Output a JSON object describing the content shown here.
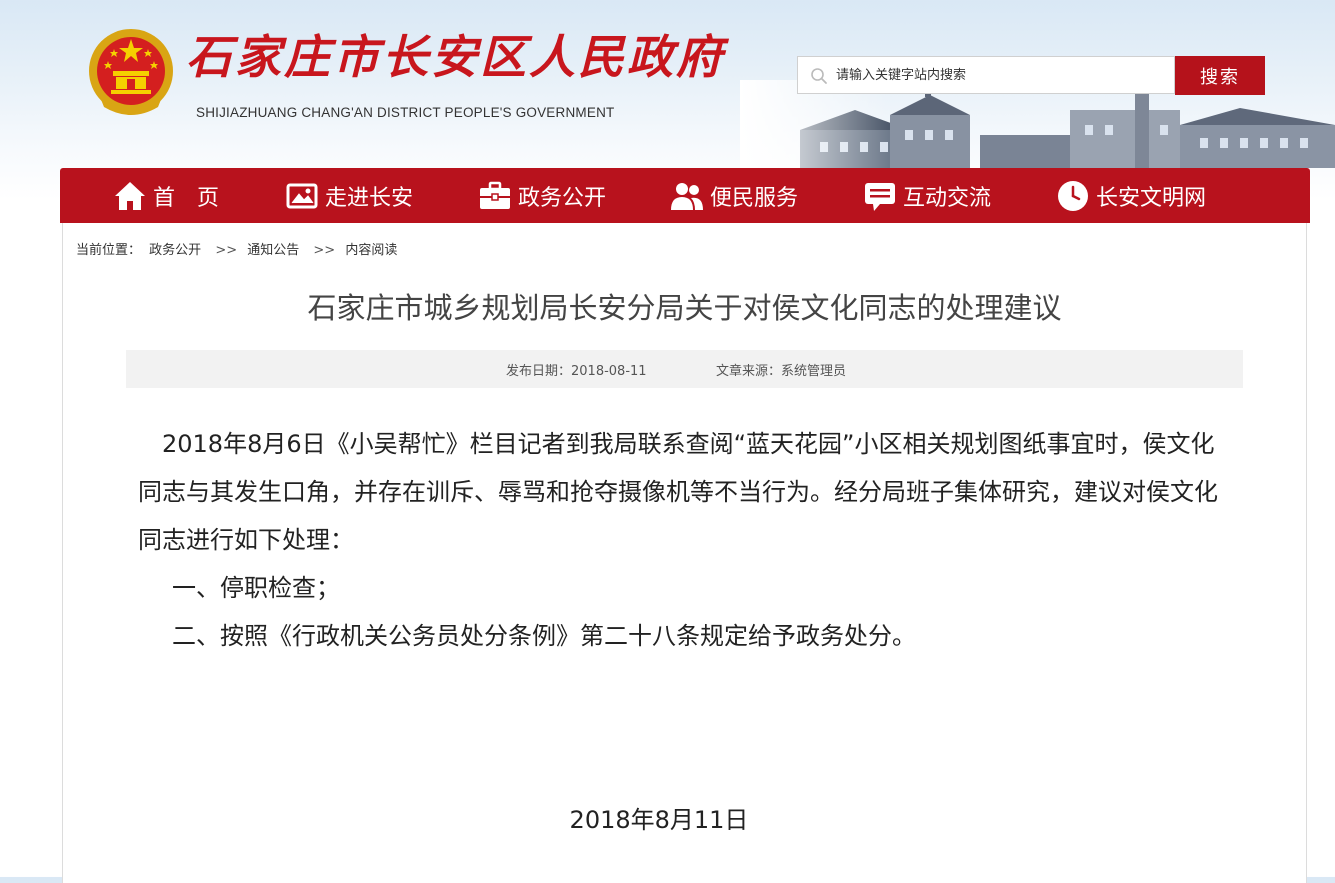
{
  "header": {
    "title": "石家庄市长安区人民政府",
    "subtitle": "SHIJIAZHUANG CHANG'AN DISTRICT PEOPLE'S GOVERNMENT",
    "search_placeholder": "请输入关键字站内搜索",
    "search_button": "搜索"
  },
  "colors": {
    "brand_red": "#b8121d",
    "button_red": "#b5121b",
    "meta_bg": "#f2f2f2"
  },
  "nav": {
    "items": [
      {
        "label": "首页",
        "icon": "home-icon"
      },
      {
        "label": "走进长安",
        "icon": "picture-icon"
      },
      {
        "label": "政务公开",
        "icon": "briefcase-icon"
      },
      {
        "label": "便民服务",
        "icon": "people-icon"
      },
      {
        "label": "互动交流",
        "icon": "chat-icon"
      },
      {
        "label": "长安文明网",
        "icon": "clock-icon"
      }
    ]
  },
  "breadcrumb": {
    "prefix": "当前位置：",
    "items": [
      "政务公开",
      "通知公告",
      "内容阅读"
    ],
    "separator": ">>"
  },
  "article": {
    "title": "石家庄市城乡规划局长安分局关于对侯文化同志的处理建议",
    "publish_date": "发布日期：2018-08-11",
    "source": "文章来源：系统管理员",
    "paragraphs": [
      "2018年8月6日《小吴帮忙》栏目记者到我局联系查阅“蓝天花园”小区相关规划图纸事宜时，侯文化同志与其发生口角，并存在训斥、辱骂和抢夺摄像机等不当行为。经分局班子集体研究，建议对侯文化同志进行如下处理：",
      "一、停职检查；",
      "二、按照《行政机关公务员处分条例》第二十八条规定给予政务处分。"
    ],
    "date": "2018年8月11日"
  }
}
